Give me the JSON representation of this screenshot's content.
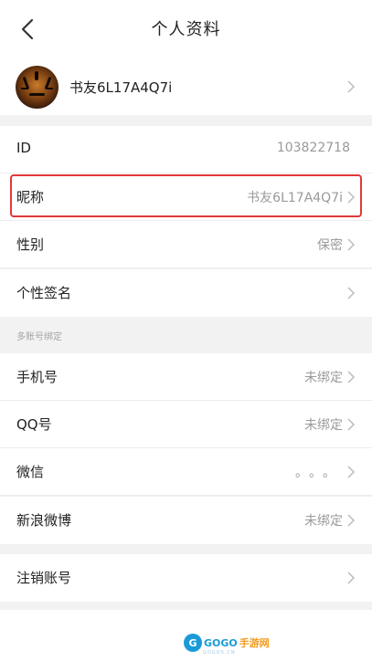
{
  "header": {
    "title": "个人资料"
  },
  "profile": {
    "name": "书友6L17A4Q7i"
  },
  "rows": {
    "id": {
      "label": "ID",
      "value": "103822718"
    },
    "nickname": {
      "label": "昵称",
      "value": "书友6L17A4Q7i"
    },
    "gender": {
      "label": "性别",
      "value": "保密"
    },
    "signature": {
      "label": "个性签名",
      "value": ""
    }
  },
  "binding": {
    "section_label": "多账号绑定",
    "phone": {
      "label": "手机号",
      "value": "未绑定"
    },
    "qq": {
      "label": "QQ号",
      "value": "未绑定"
    },
    "wechat": {
      "label": "微信",
      "value": "。。。"
    },
    "weibo": {
      "label": "新浪微博",
      "value": "未绑定"
    }
  },
  "account": {
    "deactivate_label": "注销账号"
  },
  "watermark": {
    "brand_a": "GOGO",
    "brand_b": "手游网",
    "sub": "GOGOS.CN"
  },
  "colors": {
    "highlight": "#e0393a",
    "value_gray": "#9a9a9a",
    "background": "#f2f2f2"
  }
}
